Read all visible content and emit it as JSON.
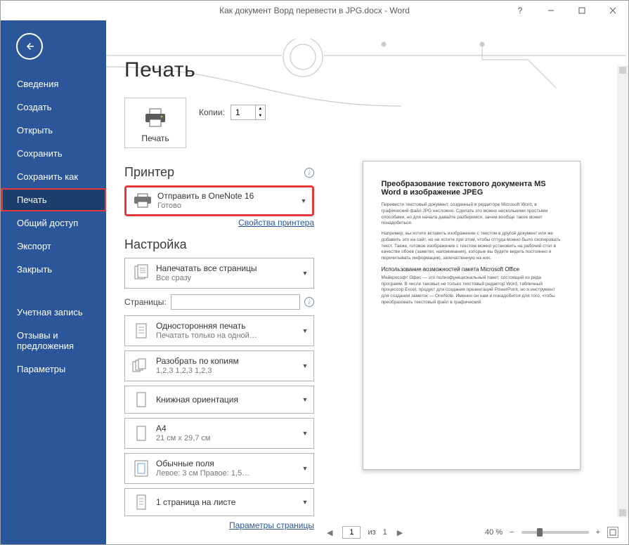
{
  "window": {
    "title": "Как документ Ворд перевести в JPG.docx - Word"
  },
  "sidebar": {
    "items": [
      {
        "label": "Сведения"
      },
      {
        "label": "Создать"
      },
      {
        "label": "Открыть"
      },
      {
        "label": "Сохранить"
      },
      {
        "label": "Сохранить как"
      },
      {
        "label": "Печать"
      },
      {
        "label": "Общий доступ"
      },
      {
        "label": "Экспорт"
      },
      {
        "label": "Закрыть"
      }
    ],
    "bottom": [
      {
        "label": "Учетная запись"
      },
      {
        "label": "Отзывы и предложения"
      },
      {
        "label": "Параметры"
      }
    ]
  },
  "page": {
    "title": "Печать",
    "print_button": "Печать",
    "copies_label": "Копии:",
    "copies_value": "1",
    "printer_heading": "Принтер",
    "printer_selected": "Отправить в OneNote 16",
    "printer_status": "Готово",
    "printer_props_link": "Свойства принтера",
    "settings_heading": "Настройка",
    "setting_all_pages": "Напечатать все страницы",
    "setting_all_pages_sub": "Все сразу",
    "pages_label": "Страницы:",
    "pages_value": "",
    "duplex": "Односторонняя печать",
    "duplex_sub": "Печатать только на одной…",
    "collate": "Разобрать по копиям",
    "collate_sub": "1,2,3     1,2,3     1,2,3",
    "orientation": "Книжная ориентация",
    "paper": "A4",
    "paper_sub": "21 см x 29,7 см",
    "margins": "Обычные поля",
    "margins_sub": "Левое:   3 см    Правое:   1,5…",
    "sheets": "1 страница на листе",
    "page_setup_link": "Параметры страницы"
  },
  "preview": {
    "title": "Преобразование текстового документа MS Word в изображение JPEG",
    "p1": "Перевести текстовый документ, созданный в редакторе Microsoft Word, в графический файл JPG несложно. Сделать это можно несколькими простыми способами, но для начала давайте разберемся, зачем вообще такое может понадобиться.",
    "p2": "Например, вы хотите вставить изображение с текстом в другой документ или же добавить это на сайт, но не хотите при этом, чтобы оттуда можно было скопировать текст. Также, готовое изображение с текстом можно установить на рабочий стол в качестве обоев (заметки, напоминания), которые вы будете видеть постоянно и перечитывать информацию, запечатленную на них.",
    "sect": "Использование возможностей пакета Microsoft Office",
    "p3": "Майкрософт Офис — это полнофункциональный пакет, состоящий из ряда программ. В числе таковых не только текстовый редактор Word, табличный процессор Excel, продукт для создания презентаций PowerPoint, но и инструмент для создания заметок — OneNote. Именно он нам и понадобится для того, чтобы преобразовать текстовый файл в графический."
  },
  "footer": {
    "page_current": "1",
    "page_total_prefix": "из",
    "page_total": "1",
    "zoom_percent": "40 %"
  }
}
